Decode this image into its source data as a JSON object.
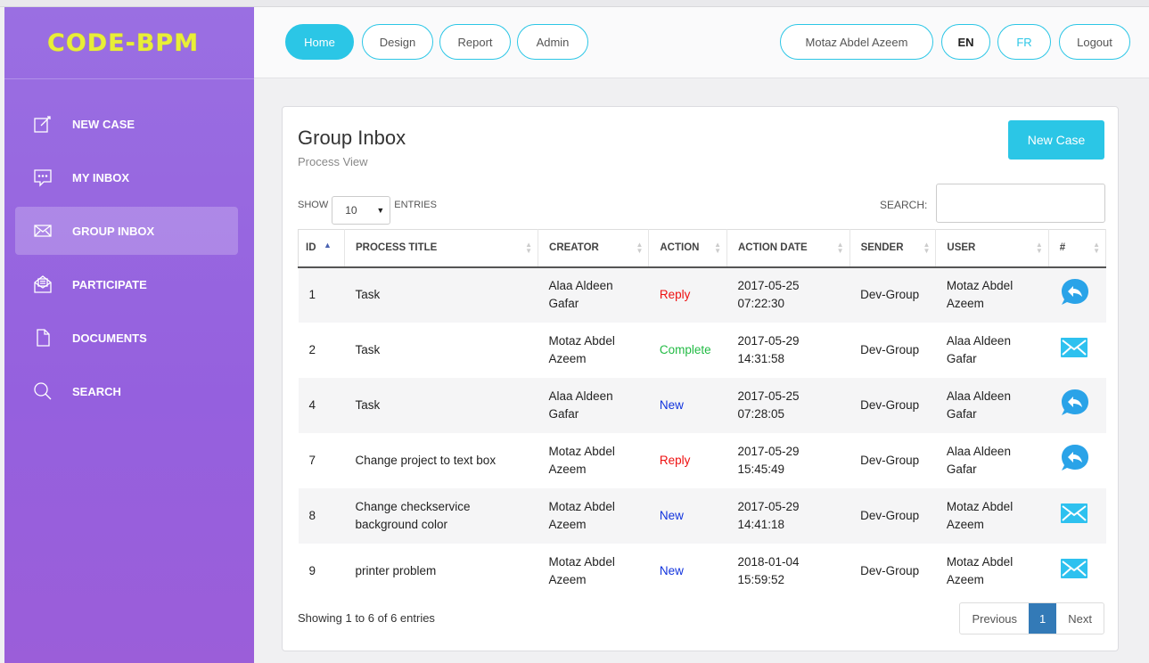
{
  "brand": {
    "logo": "CODE-BPM",
    "logo_color": "#e8ee37"
  },
  "sidebar": {
    "items": [
      {
        "label": "NEW CASE",
        "icon": "edit-icon"
      },
      {
        "label": "MY INBOX",
        "icon": "message-icon"
      },
      {
        "label": "GROUP INBOX",
        "icon": "envelope-icon",
        "active": true
      },
      {
        "label": "PARTICIPATE",
        "icon": "mail-open-icon"
      },
      {
        "label": "DOCUMENTS",
        "icon": "document-icon"
      },
      {
        "label": "SEARCH",
        "icon": "search-icon"
      }
    ]
  },
  "topnav": {
    "home": "Home",
    "design": "Design",
    "report": "Report",
    "admin": "Admin",
    "user": "Motaz Abdel Azeem",
    "lang_en": "EN",
    "lang_fr": "FR",
    "logout": "Logout"
  },
  "card": {
    "title": "Group Inbox",
    "subtitle": "Process View",
    "new_case": "New Case",
    "show": "SHOW",
    "entries_value": "10",
    "entries": "ENTRIES",
    "search_label": "SEARCH:",
    "search_value": ""
  },
  "table": {
    "headers": [
      "ID",
      "PROCESS TITLE",
      "CREATOR",
      "ACTION",
      "ACTION DATE",
      "SENDER",
      "USER",
      "#"
    ],
    "rows": [
      {
        "id": "1",
        "title": "Task",
        "creator": "Alaa Aldeen Gafar",
        "action": "Reply",
        "date": "2017-05-25 07:22:30",
        "sender": "Dev-Group",
        "user": "Motaz Abdel Azeem",
        "icon": "reply-icon"
      },
      {
        "id": "2",
        "title": "Task",
        "creator": "Motaz Abdel Azeem",
        "action": "Complete",
        "date": "2017-05-29 14:31:58",
        "sender": "Dev-Group",
        "user": "Alaa Aldeen Gafar",
        "icon": "mail-icon"
      },
      {
        "id": "4",
        "title": "Task",
        "creator": "Alaa Aldeen Gafar",
        "action": "New",
        "date": "2017-05-25 07:28:05",
        "sender": "Dev-Group",
        "user": "Alaa Aldeen Gafar",
        "icon": "reply-icon"
      },
      {
        "id": "7",
        "title": "Change project to text box",
        "creator": "Motaz Abdel Azeem",
        "action": "Reply",
        "date": "2017-05-29 15:45:49",
        "sender": "Dev-Group",
        "user": "Alaa Aldeen Gafar",
        "icon": "reply-icon"
      },
      {
        "id": "8",
        "title": "Change checkservice background color",
        "creator": "Motaz Abdel Azeem",
        "action": "New",
        "date": "2017-05-29 14:41:18",
        "sender": "Dev-Group",
        "user": "Motaz Abdel Azeem",
        "icon": "mail-icon"
      },
      {
        "id": "9",
        "title": "printer problem",
        "creator": "Motaz Abdel Azeem",
        "action": "New",
        "date": "2018-01-04 15:59:52",
        "sender": "Dev-Group",
        "user": "Motaz Abdel Azeem",
        "icon": "mail-icon"
      }
    ]
  },
  "action_colors": {
    "Reply": "#ee1111",
    "Complete": "#22bb44",
    "New": "#1133dd"
  },
  "footer": {
    "info": "Showing 1 to 6 of 6 entries",
    "previous": "Previous",
    "page": "1",
    "next": "Next"
  },
  "colors": {
    "accent": "#2bc6e6",
    "sidebar": "#9a6fe2",
    "pager_active": "#337ab7"
  }
}
